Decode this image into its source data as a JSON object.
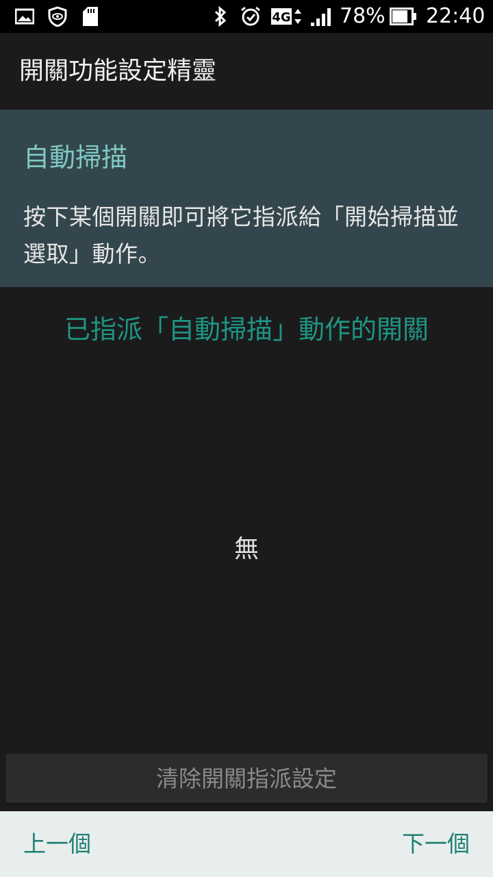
{
  "status_bar": {
    "icons_left": [
      "image-icon",
      "shield-eye-icon",
      "sd-card-icon"
    ],
    "icons_right": [
      "bluetooth-icon",
      "alarm-icon",
      "network-4g-icon",
      "signal-icon",
      "battery-icon"
    ],
    "network": "4G",
    "battery": "78%",
    "time": "22:40"
  },
  "app_bar": {
    "title": "開關功能設定精靈"
  },
  "info_panel": {
    "title": "自動掃描",
    "description": "按下某個開關即可將它指派給「開始掃描並選取」動作。"
  },
  "section": {
    "heading": "已指派「自動掃描」動作的開關",
    "empty_value": "無"
  },
  "actions": {
    "clear_label": "清除開關指派設定"
  },
  "bottom_nav": {
    "prev_label": "上一個",
    "next_label": "下一個"
  },
  "colors": {
    "accent": "#1f9484",
    "info_panel_bg": "#33464d",
    "info_title": "#7fc9c1",
    "bottom_bar_bg": "#e8eeed"
  }
}
